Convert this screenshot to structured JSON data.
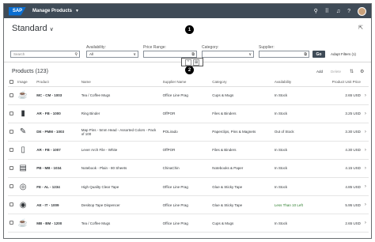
{
  "shell": {
    "logo": "SAP",
    "app_title": "Manage Products"
  },
  "header": {
    "variant": "Standard",
    "marker1": "1",
    "marker2": "2",
    "filters": {
      "search_placeholder": "Search",
      "availability_label": "Availability:",
      "availability_value": "All",
      "price_label": "Price Range:",
      "category_label": "Category:",
      "supplier_label": "Supplier:"
    },
    "go_label": "Go",
    "adapt_label": "Adapt Filters (1)"
  },
  "table": {
    "title": "Products (123)",
    "add_label": "Add",
    "delete_label": "Delete",
    "columns": [
      "Image",
      "Product",
      "Name",
      "Supplier Name",
      "Category",
      "Availability",
      "Product Unit Price"
    ],
    "rows": [
      {
        "product": "MC - CM - 1003",
        "name": "Tea / Coffee Mugs",
        "supplier": "Office Line Prag",
        "category": "Cups & Mugs",
        "availability": "In Stock",
        "price": "2.65 USD",
        "icon": "mug-icon"
      },
      {
        "product": "AR - FB - 1000",
        "name": "Ring Binder",
        "supplier": "OffPOR",
        "category": "Files & Binders",
        "availability": "In Stock",
        "price": "3.25 USD",
        "icon": "binder-icon"
      },
      {
        "product": "DE - PMM - 1003",
        "name": "Map Pins - 5mm Head - Assorted Colors - Pack of 100",
        "supplier": "POLirado",
        "category": "Paperclips, Pins & Magnets",
        "availability": "Out of Stock",
        "price": "3.30 USD",
        "icon": "pins-icon"
      },
      {
        "product": "AR - FB - 1007",
        "name": "Lever Arch File - White",
        "supplier": "OffPOR",
        "category": "Files & Binders",
        "availability": "In Stock",
        "price": "4.30 USD",
        "icon": "file-icon"
      },
      {
        "product": "PB - MB - 1034",
        "name": "Notebook - Plain - 80 Sheets",
        "supplier": "ChinaChin",
        "category": "Notebooks & Paper",
        "availability": "In Stock",
        "price": "4.15 USD",
        "icon": "notebook-icon"
      },
      {
        "product": "FE - AL - 1234",
        "name": "High Quality Clear Tape",
        "supplier": "Office Line Prag",
        "category": "Glue & Sticky Tape",
        "availability": "In Stock",
        "price": "4.85 USD",
        "icon": "tape-icon"
      },
      {
        "product": "AE - IT - 1009",
        "name": "Desktop Tape Dispencer",
        "supplier": "Office Line Prag",
        "category": "Glue & Sticky Tape",
        "availability": "Less Than 10 Left",
        "price": "5.95 USD",
        "icon": "dispenser-icon"
      },
      {
        "product": "MB - BM - 1200",
        "name": "Tea / Coffee Mugs",
        "supplier": "Office Line Prag",
        "category": "Cups & Mugs",
        "availability": "In Stock",
        "price": "2.65 USD",
        "icon": "mug-icon"
      }
    ]
  }
}
